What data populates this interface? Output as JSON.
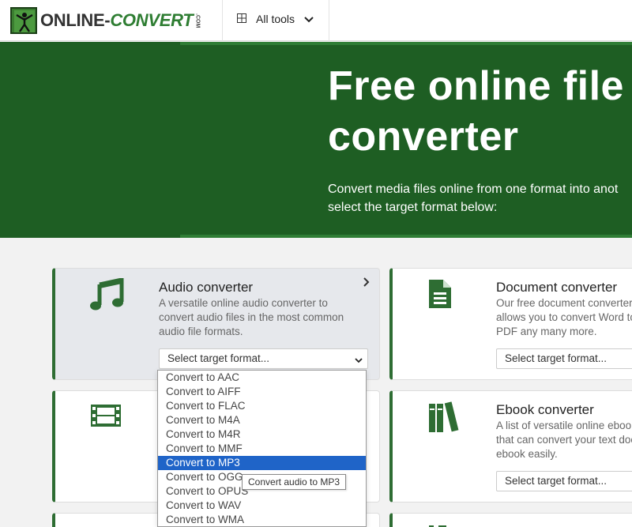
{
  "header": {
    "logo": {
      "text_main": "ONLINE-",
      "text_accent": "CONVERT",
      "text_com": ".COM"
    },
    "all_tools_label": "All tools"
  },
  "hero": {
    "title": "Free online file converter",
    "subtitle_line1": "Convert media files online from one format into anot",
    "subtitle_line2": "select the target format below:"
  },
  "cards": [
    {
      "title": "Audio converter",
      "desc": "A versatile online audio converter to convert audio files in the most common audio file formats.",
      "select_value": "Select target format...",
      "icon": "music-note-icon"
    },
    {
      "title": "Document converter",
      "desc": "Our free document converter allows you to convert Word to PDF any many more.",
      "select_value": "Select target format...",
      "icon": "document-icon"
    },
    {
      "title": "",
      "desc": "",
      "select_value": "",
      "icon": "film-icon"
    },
    {
      "title": "Ebook converter",
      "desc": "A list of versatile online ebook that can convert your text doc ebook easily.",
      "select_value": "Select target format...",
      "icon": "books-icon"
    }
  ],
  "dropdown": {
    "options": [
      "Convert to AAC",
      "Convert to AIFF",
      "Convert to FLAC",
      "Convert to M4A",
      "Convert to M4R",
      "Convert to MMF",
      "Convert to MP3",
      "Convert to OGG",
      "Convert to OPUS",
      "Convert to WAV",
      "Convert to WMA"
    ],
    "selected_index": 6,
    "tooltip": "Convert audio to MP3"
  },
  "colors": {
    "brand_green": "#1e5e23",
    "accent_green": "#2e6d33",
    "selection_blue": "#1f64c8"
  }
}
